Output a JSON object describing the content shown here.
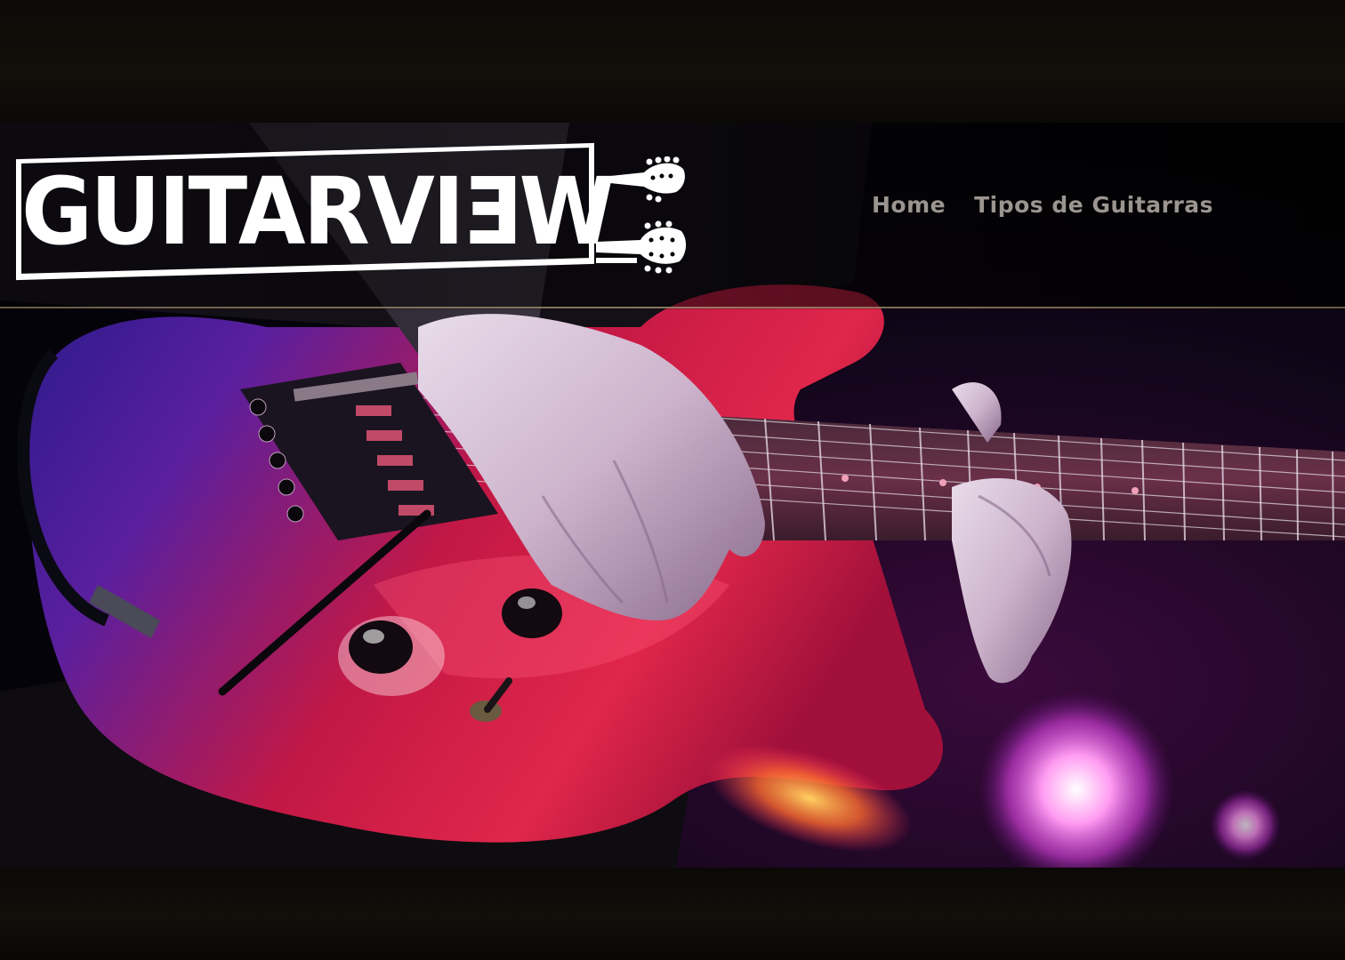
{
  "logo": {
    "text": "GUITARVIƎW"
  },
  "nav": {
    "items": [
      {
        "label": "Home"
      },
      {
        "label": "Tipos de Guitarras"
      }
    ]
  },
  "colors": {
    "nav_text": "#9a9590",
    "header_rule": "#a08a6c",
    "page_background": "#0a0806",
    "guitar_body": "#d01a3c"
  },
  "hero": {
    "image_subject": "guitar-photo"
  }
}
